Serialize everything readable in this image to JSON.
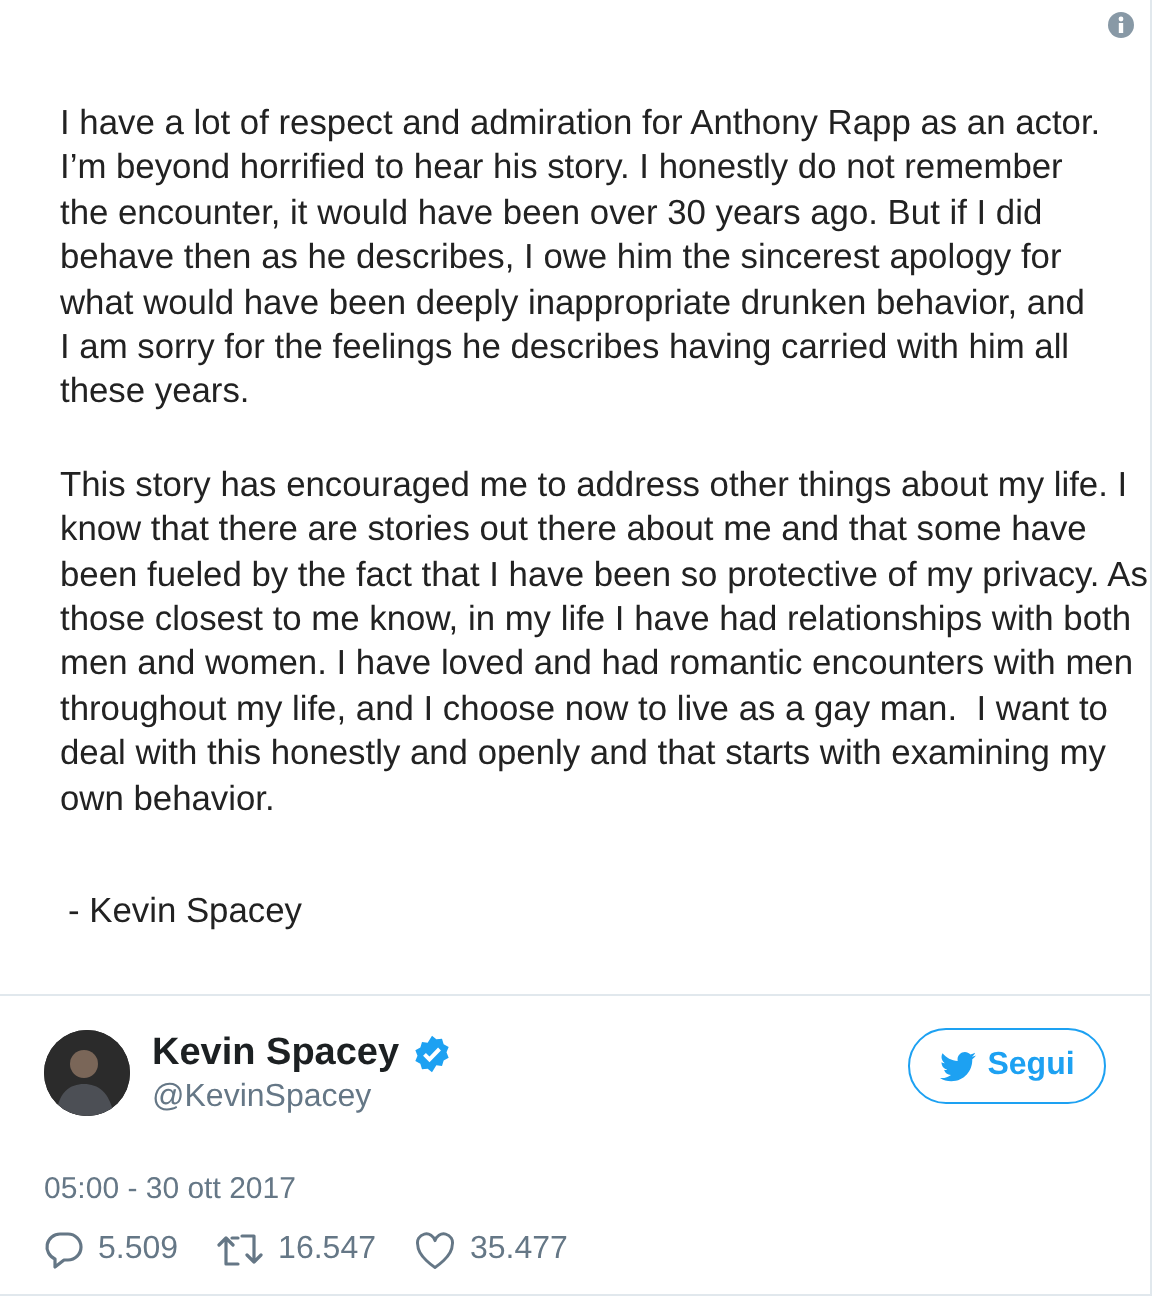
{
  "statement": {
    "paragraphs": [
      {
        "lines": [
          "I have a lot of respect and admiration for Anthony Rapp as an actor.",
          "I’m beyond horrified to hear his story. I honestly do not remember",
          "the encounter, it would have been over 30 years ago. But if I did",
          "behave then as he describes, I owe him the sincerest apology for",
          "what would have been deeply inappropriate drunken behavior, and",
          "I am sorry for the feelings he describes having carried with him all",
          "these years."
        ]
      },
      {
        "lines": [
          "This story has encouraged me to address other things about my life. I",
          "know that there are stories out there about me and that some have",
          "been fueled by the fact that I have been so protective of my privacy. As",
          "those closest to me know, in my life I have had relationships with both",
          "men and women. I have loved and had romantic encounters with men",
          "throughout my life, and I choose now to live as a gay man.  I want to",
          "deal with this honestly and openly and that starts with examining my",
          "own behavior."
        ]
      }
    ],
    "signature": "- Kevin Spacey"
  },
  "author": {
    "name": "Kevin Spacey",
    "verified": true,
    "handle": "@KevinSpacey"
  },
  "follow_button": "Segui",
  "timestamp": "05:00 - 30 ott 2017",
  "actions": [
    {
      "kind": "reply",
      "count": "5.509"
    },
    {
      "kind": "retweet",
      "count": "16.547"
    },
    {
      "kind": "like",
      "count": "35.477"
    }
  ]
}
